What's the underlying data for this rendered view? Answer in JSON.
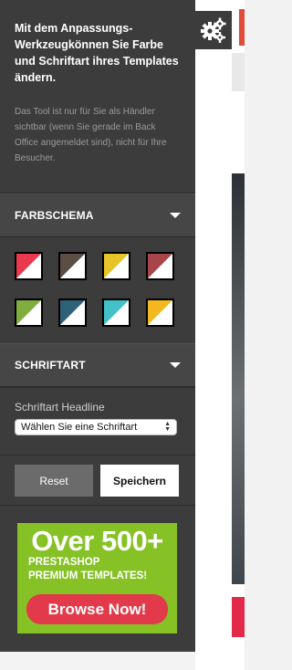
{
  "intro": {
    "title": "Mit dem Anpassungs-Werkzeugkönnen Sie Farbe und Schriftart ihres Templates ändern.",
    "description": "Das Tool ist nur für Sie als Händler sichtbar (wenn Sie gerade im Back Office angemeldet sind), nicht für Ihre Besucher."
  },
  "color_section": {
    "title": "FARBSCHEMA",
    "swatches": [
      {
        "color": "#e8394d"
      },
      {
        "color": "#5c4d45"
      },
      {
        "color": "#e8c42a"
      },
      {
        "color": "#a7454a"
      },
      {
        "color": "#7fad3e"
      },
      {
        "color": "#2d6278"
      },
      {
        "color": "#40c2c8"
      },
      {
        "color": "#f3b81e"
      }
    ]
  },
  "font_section": {
    "title": "SCHRIFTART",
    "headline_label": "Schriftart Headline",
    "select_value": "Wählen Sie eine Schriftart"
  },
  "actions": {
    "reset_label": "Reset",
    "save_label": "Speichern"
  },
  "ad": {
    "title": "Over 500+",
    "line1": "PRESTASHOP",
    "line2": "PREMIUM TEMPLATES!",
    "button_label": "Browse Now!"
  },
  "icons": {
    "settings": "gears-icon",
    "collapse": "caret-down-icon"
  }
}
